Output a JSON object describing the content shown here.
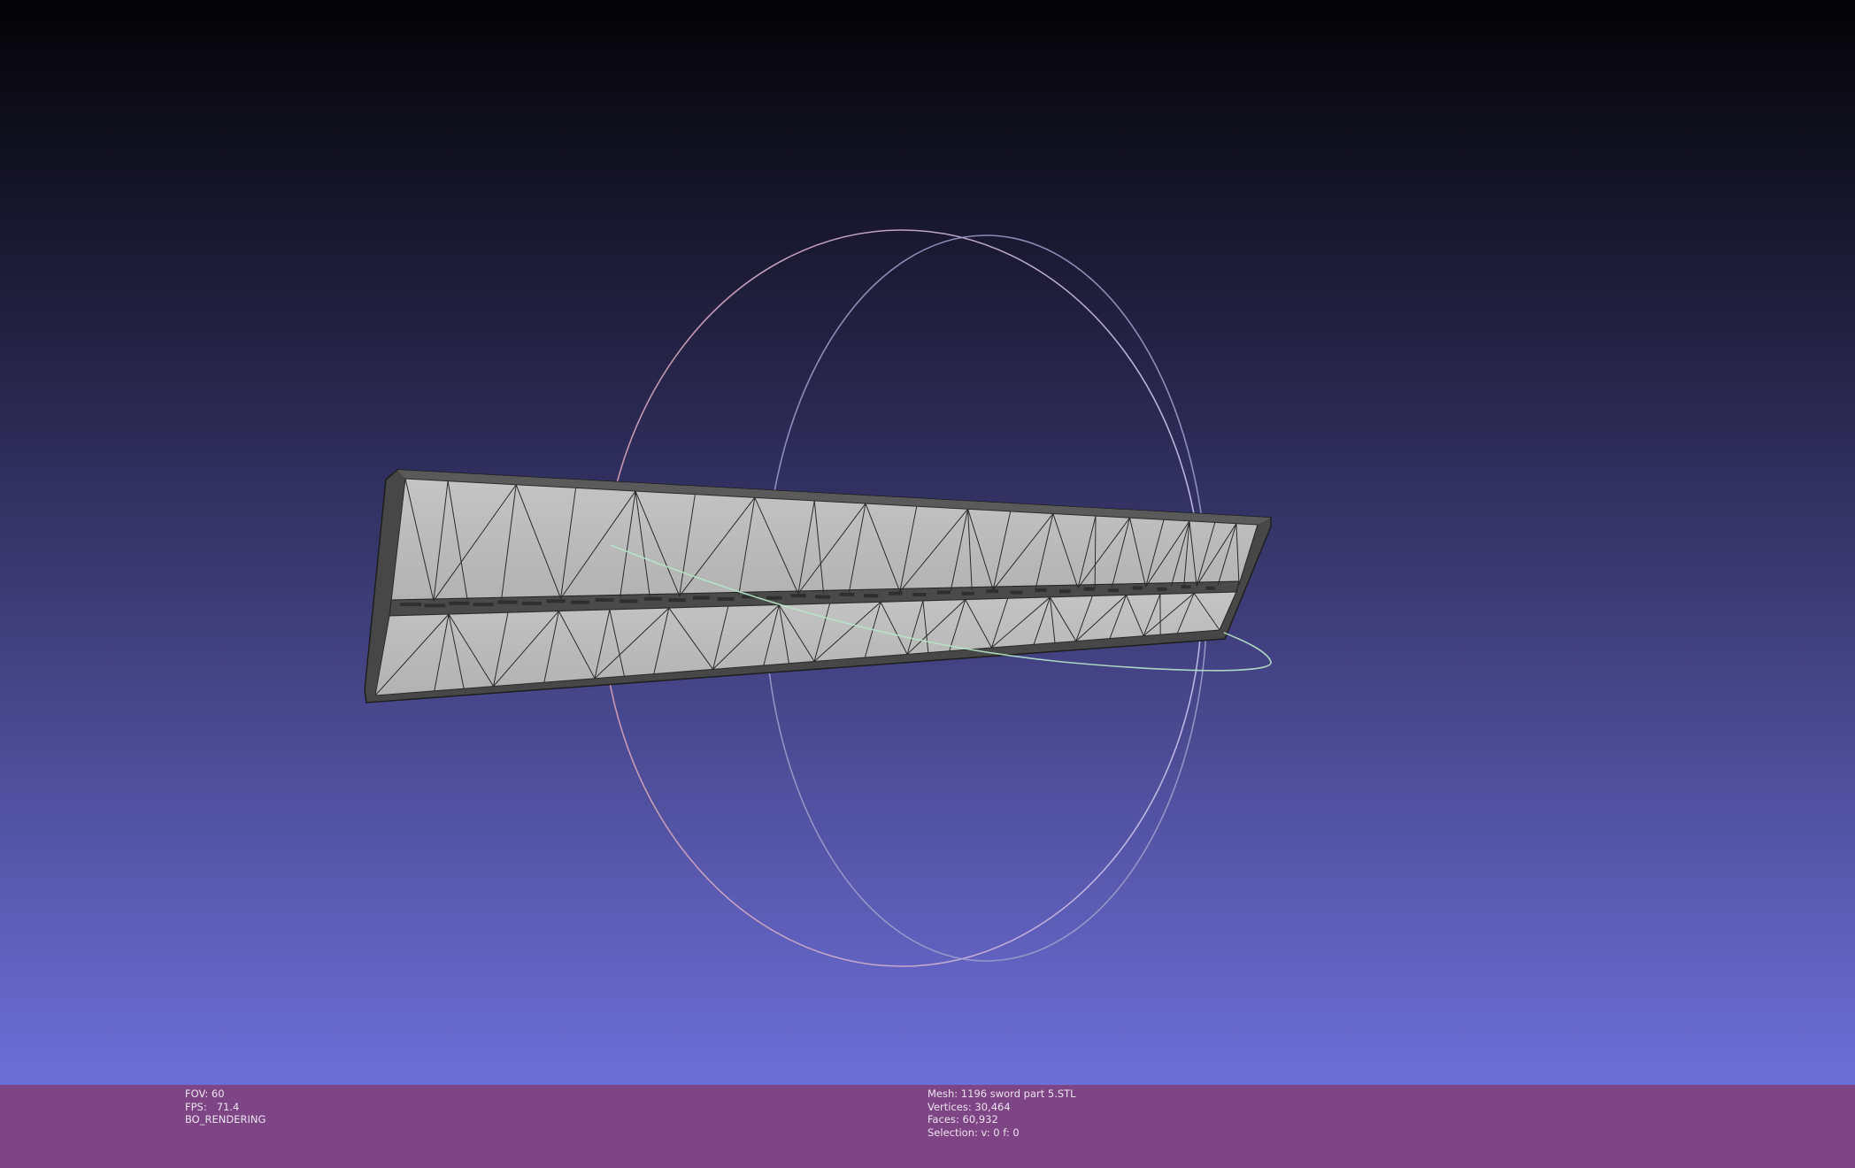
{
  "colors": {
    "background_top": "#030305",
    "background_bottom": "#7577e9",
    "info_bar": "#7e4585",
    "info_text": "#ece2ee",
    "mesh_face": "#bdbdbd",
    "mesh_edge": "#2b2b2b",
    "mesh_rim": "#474747",
    "trackball_x": "#c49ab6",
    "trackball_y": "#9a9ec8",
    "trackball_z": "#b8e4c9"
  },
  "status_left": {
    "fov": "FOV: 60",
    "fps": "FPS:   71.4",
    "mode": "BO_RENDERING"
  },
  "status_right": {
    "mesh": "Mesh: 1196 sword part 5.STL",
    "vertices": "Vertices: 30,464",
    "faces": "Faces: 60,932",
    "selection": "Selection: v: 0 f: 0"
  }
}
